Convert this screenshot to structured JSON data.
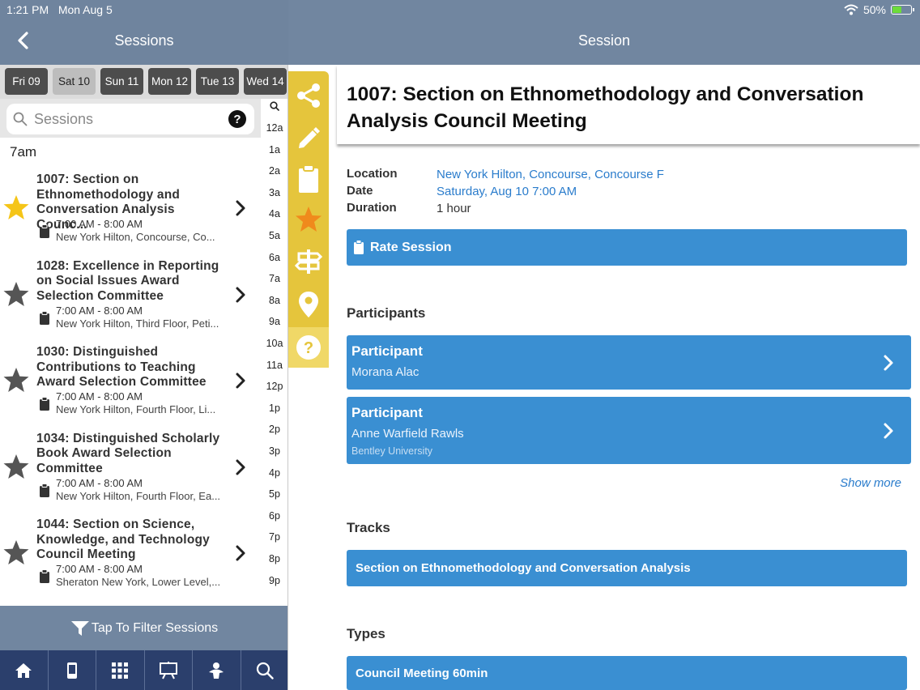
{
  "status": {
    "time": "1:21 PM",
    "date": "Mon Aug 5",
    "battery": "50%",
    "battery_level": 0.5
  },
  "left_header": {
    "title": "Sessions"
  },
  "right_header": {
    "title": "Session"
  },
  "days": [
    "Fri 09",
    "Sat 10",
    "Sun 11",
    "Mon 12",
    "Tue 13",
    "Wed 14"
  ],
  "active_day": "Sat 10",
  "search": {
    "placeholder": "Sessions"
  },
  "hour_index": [
    "12a",
    "1a",
    "2a",
    "3a",
    "4a",
    "5a",
    "6a",
    "7a",
    "8a",
    "9a",
    "10a",
    "11a",
    "12p",
    "1p",
    "2p",
    "3p",
    "4p",
    "5p",
    "6p",
    "7p",
    "8p",
    "9p"
  ],
  "list": {
    "hour_header": "7am",
    "sessions": [
      {
        "title": "1007: Section on Ethnomethodology and Conversation Analysis Counc...",
        "time": "7:00 AM - 8:00 AM",
        "location": "New York Hilton, Concourse, Co...",
        "favorite": true
      },
      {
        "title": "1028: Excellence in Reporting on Social Issues Award Selection Committee",
        "time": "7:00 AM - 8:00 AM",
        "location": "New York Hilton, Third Floor, Peti...",
        "favorite": false
      },
      {
        "title": "1030: Distinguished Contributions to Teaching Award Selection Committee",
        "time": "7:00 AM - 8:00 AM",
        "location": "New York Hilton, Fourth Floor, Li...",
        "favorite": false
      },
      {
        "title": "1034: Distinguished Scholarly Book Award Selection Committee",
        "time": "7:00 AM - 8:00 AM",
        "location": "New York Hilton, Fourth Floor, Ea...",
        "favorite": false
      },
      {
        "title": "1044: Section on Science, Knowledge, and Technology Council Meeting",
        "time": "7:00 AM - 8:00 AM",
        "location": "Sheraton New York, Lower Level,...",
        "favorite": false
      }
    ]
  },
  "filter": {
    "label": "Tap To Filter Sessions"
  },
  "bottom_nav": [
    "home-icon",
    "phone-icon",
    "grid-icon",
    "presentation-icon",
    "people-icon",
    "search-icon"
  ],
  "toolbar": [
    "share-icon",
    "pencil-icon",
    "clipboard-icon",
    "star-icon",
    "signpost-icon",
    "location-pin-icon",
    "help-icon"
  ],
  "detail": {
    "title": "1007: Section on Ethnomethodology and Conversation Analysis Council Meeting",
    "location_label": "Location",
    "location": "New York Hilton, Concourse, Concourse F",
    "date_label": "Date",
    "date": "Saturday, Aug 10 7:00 AM",
    "duration_label": "Duration",
    "duration": "1 hour",
    "rate_label": "Rate Session",
    "participants_heading": "Participants",
    "participants": [
      {
        "role": "Participant",
        "name": "Morana Alac",
        "affiliation": ""
      },
      {
        "role": "Participant",
        "name": "Anne Warfield Rawls",
        "affiliation": "Bentley University"
      }
    ],
    "show_more": "Show more",
    "tracks_heading": "Tracks",
    "track": "Section on Ethnomethodology and Conversation Analysis",
    "types_heading": "Types",
    "type": "Council Meeting 60min"
  },
  "colors": {
    "header": "#7186a0",
    "nav": "#2b3f6c",
    "accent": "#3a8fd2",
    "toolbar": "#e5c53c",
    "star_fav": "#f5c518",
    "link": "#2a7ccc"
  }
}
